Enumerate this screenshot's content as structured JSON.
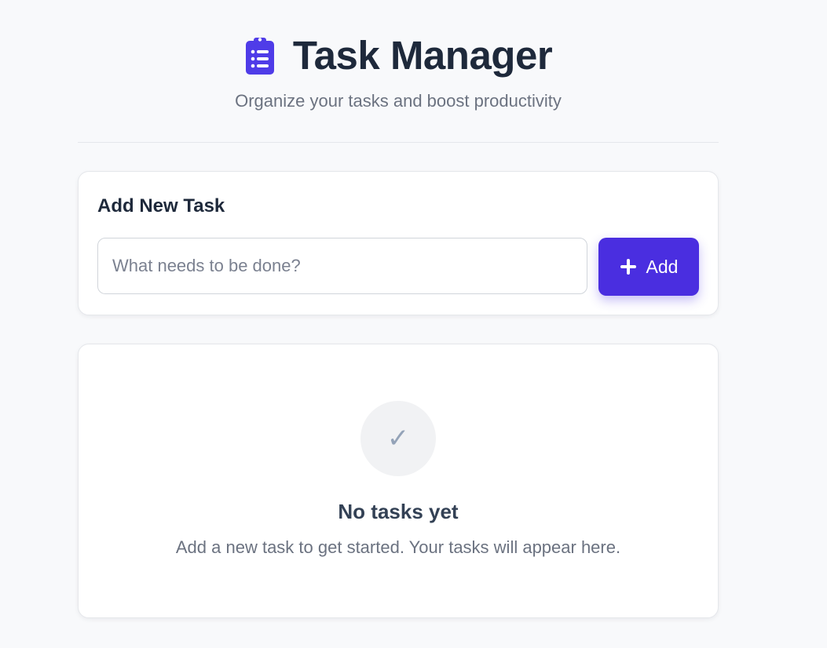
{
  "header": {
    "title": "Task Manager",
    "subtitle": "Organize your tasks and boost productivity",
    "icon": "clipboard-list-icon"
  },
  "add_task": {
    "heading": "Add New Task",
    "input_placeholder": "What needs to be done?",
    "input_value": "",
    "button_label": "Add",
    "button_icon": "plus-icon"
  },
  "empty_state": {
    "icon": "check-icon",
    "icon_glyph": "✓",
    "title": "No tasks yet",
    "message": "Add a new task to get started. Your tasks will appear here."
  },
  "colors": {
    "accent": "#4a2ee0",
    "background": "#f8f9fb",
    "title_text": "#1e293b",
    "muted_text": "#6b7280"
  }
}
